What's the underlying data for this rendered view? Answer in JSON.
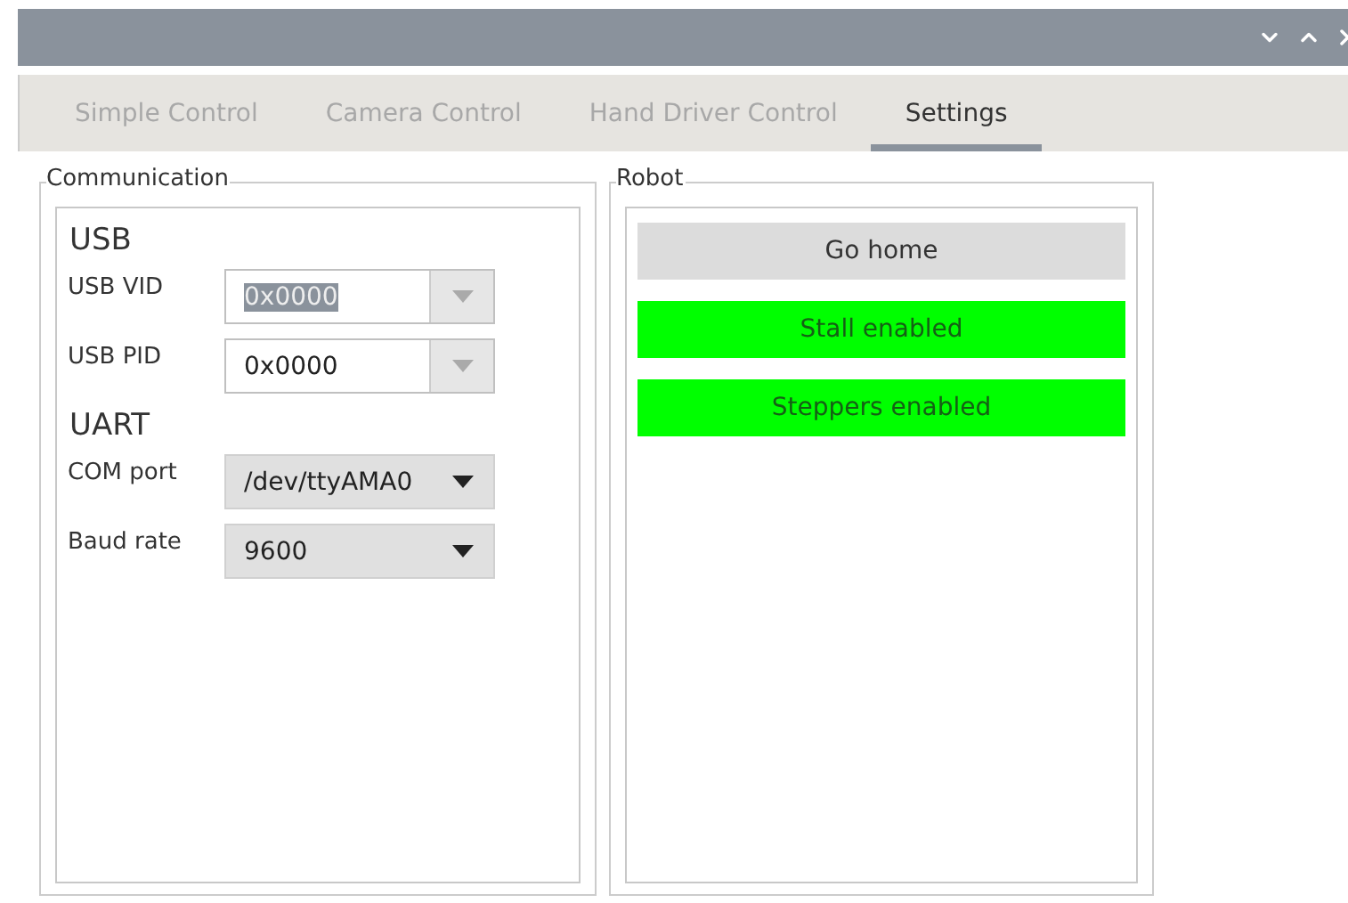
{
  "tabs": [
    {
      "label": "Simple Control",
      "selected": false
    },
    {
      "label": "Camera Control",
      "selected": false
    },
    {
      "label": "Hand Driver Control",
      "selected": false
    },
    {
      "label": "Settings",
      "selected": true
    }
  ],
  "communication": {
    "title": "Communication",
    "sections": [
      {
        "heading": "USB",
        "fields": [
          {
            "label": "USB VID",
            "value": "0x0000",
            "kind": "editable",
            "text_selected": true
          },
          {
            "label": "USB PID",
            "value": "0x0000",
            "kind": "editable",
            "text_selected": false
          }
        ]
      },
      {
        "heading": "UART",
        "fields": [
          {
            "label": "COM port",
            "value": "/dev/ttyAMA0",
            "kind": "select",
            "text_selected": false
          },
          {
            "label": "Baud rate",
            "value": "9600",
            "kind": "select",
            "text_selected": false
          }
        ]
      }
    ]
  },
  "robot": {
    "title": "Robot",
    "buttons": [
      {
        "label": "Go home",
        "on": false
      },
      {
        "label": "Stall enabled",
        "on": true
      },
      {
        "label": "Steppers enabled",
        "on": true
      }
    ]
  }
}
